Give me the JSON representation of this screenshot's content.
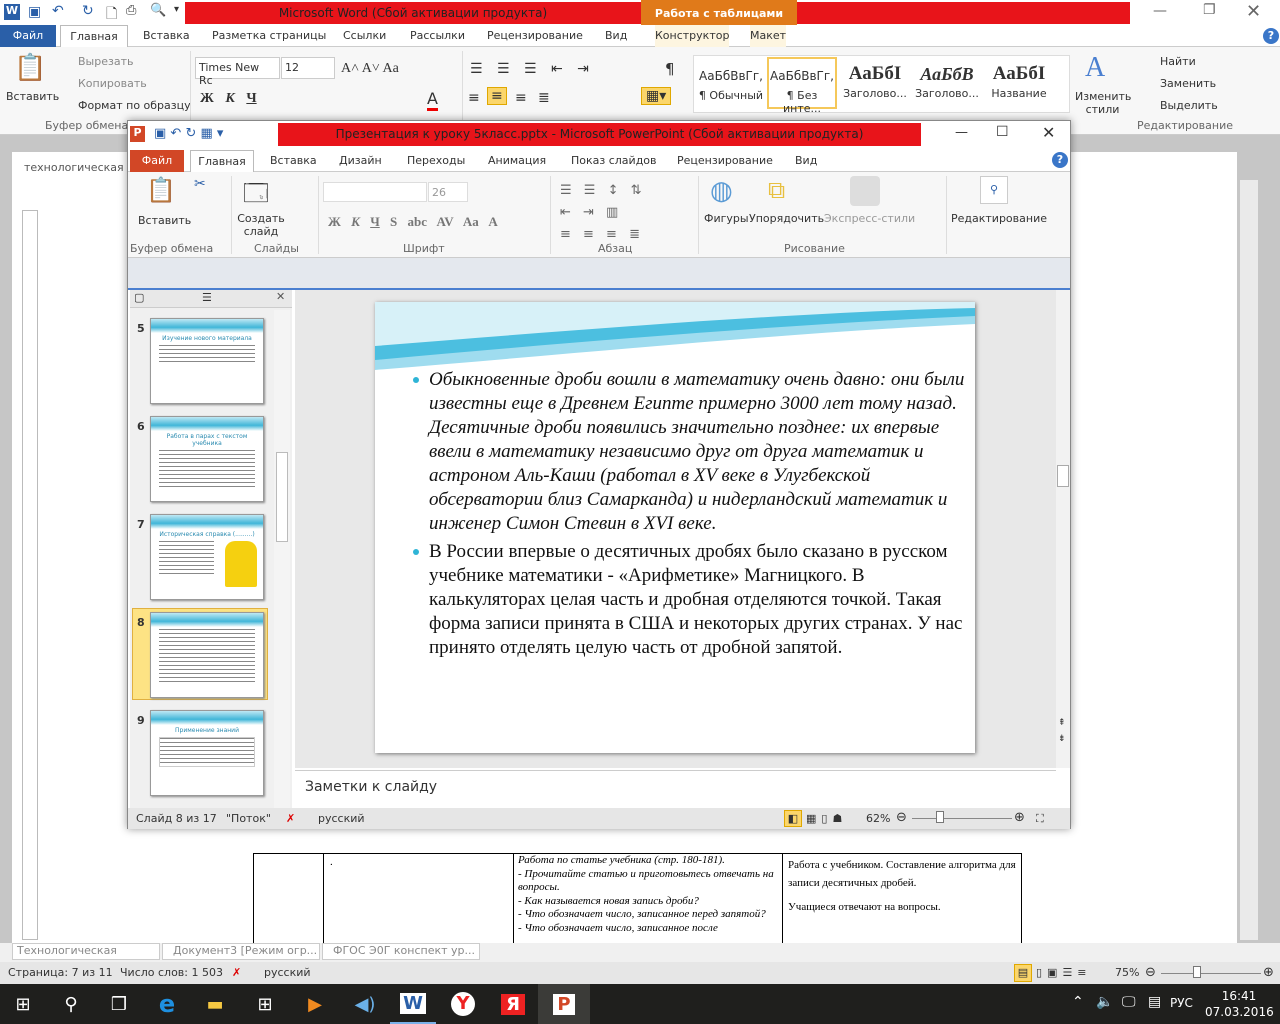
{
  "word": {
    "title": "Microsoft Word (Сбой активации продукта)",
    "context_tab": "Работа с таблицами",
    "tabs": [
      "Файл",
      "Главная",
      "Вставка",
      "Разметка страницы",
      "Ссылки",
      "Рассылки",
      "Рецензирование",
      "Вид",
      "Конструктор",
      "Макет"
    ],
    "clipboard": {
      "paste": "Вставить",
      "cut": "Вырезать",
      "copy": "Копировать",
      "format": "Формат по образцу",
      "group": "Буфер обмена"
    },
    "font_name": "Times New Rc",
    "font_size": "12",
    "styles": [
      {
        "sample": "АаБбВвГг,",
        "name": "¶ Обычный"
      },
      {
        "sample": "АаБбВвГг,",
        "name": "¶ Без инте..."
      },
      {
        "sample": "АаБбI",
        "name": "Заголово..."
      },
      {
        "sample": "АаБбВ",
        "name": "Заголово..."
      },
      {
        "sample": "АаБбI",
        "name": "Название"
      }
    ],
    "change_styles": "Изменить стили",
    "editing": {
      "find": "Найти",
      "replace": "Заменить",
      "select": "Выделить",
      "group": "Редактирование"
    },
    "doc_heading_fragment": "технологическая к",
    "table": {
      "col2": ".",
      "col3": [
        "Работа по статье учебника (стр. 180-181).",
        "- Прочитайте статью и приготовьтесь отвечать на вопросы.",
        "- Как называется новая запись дроби?",
        "- Что обозначает число, записанное перед запятой?",
        "- Что обозначает число, записанное после"
      ],
      "col4": [
        "Работа с учебником. Составление алгоритма для записи десятичных дробей.",
        "Учащиеся отвечают на вопросы."
      ]
    },
    "doc_tabs": [
      "Технологическая карта...",
      "Документ3 [Режим огр...",
      "ФГОС Э0Г конспект ур..."
    ],
    "status": {
      "page": "Страница: 7 из 11",
      "words": "Число слов: 1 503",
      "lang": "русский",
      "zoom": "75%"
    },
    "zoom_percent": 75
  },
  "ppt": {
    "title": "Презентация к уроку 5класс.pptx - Microsoft PowerPoint (Сбой активации продукта)",
    "tabs": [
      "Файл",
      "Главная",
      "Вставка",
      "Дизайн",
      "Переходы",
      "Анимация",
      "Показ слайдов",
      "Рецензирование",
      "Вид"
    ],
    "ribbon": {
      "paste": "Вставить",
      "new_slide": "Создать слайд",
      "shapes": "Фигуры",
      "arrange": "Упорядочить",
      "quick_styles": "Экспресс-стили",
      "editing": "Редактирование",
      "font_size": "26",
      "groups": [
        "Буфер обмена",
        "Слайды",
        "Шрифт",
        "Абзац",
        "Рисование"
      ]
    },
    "thumbnails": [
      {
        "num": "5",
        "title": "Изучение нового материала"
      },
      {
        "num": "6",
        "title": "Работа в парах с текстом учебника"
      },
      {
        "num": "7",
        "title": "Историческая справка (.........)"
      },
      {
        "num": "8",
        "title": ""
      },
      {
        "num": "9",
        "title": "Применение знаний"
      }
    ],
    "selected_slide": "8",
    "slide": {
      "bullet1": "Обыкновенные дроби вошли в математику очень давно: они были известны еще в Древнем Египте примерно 3000 лет тому назад. Десятичные дроби появились значительно позднее: их впервые ввели в математику независимо друг от друга математик и астроном Аль-Каши (работал в XV веке в Улугбекской обсерватории близ Самарканда) и нидерландский математик и инженер Симон Стевин в XVI веке.",
      "bullet2": "В России впервые о десятичных дробях было сказано в русском учебнике математики - «Арифметике» Магницкого. В калькуляторах целая часть и дробная отделяются точкой. Такая форма записи принята в США и некоторых других странах. У нас принято отделять целую часть от дробной запятой."
    },
    "notes_placeholder": "Заметки к слайду",
    "status": {
      "slide": "Слайд 8 из 17",
      "theme": "\"Поток\"",
      "lang": "русский",
      "zoom": "62%"
    },
    "zoom_percent": 62
  },
  "taskbar": {
    "lang": "РУС",
    "time": "16:41",
    "date": "07.03.2016"
  },
  "colors": {
    "title_red": "#e8141a",
    "word_blue": "#2a5fa8",
    "ppt_orange": "#d24726",
    "context_orange": "#e07a1a",
    "accent_cyan": "#2eb4d6"
  }
}
